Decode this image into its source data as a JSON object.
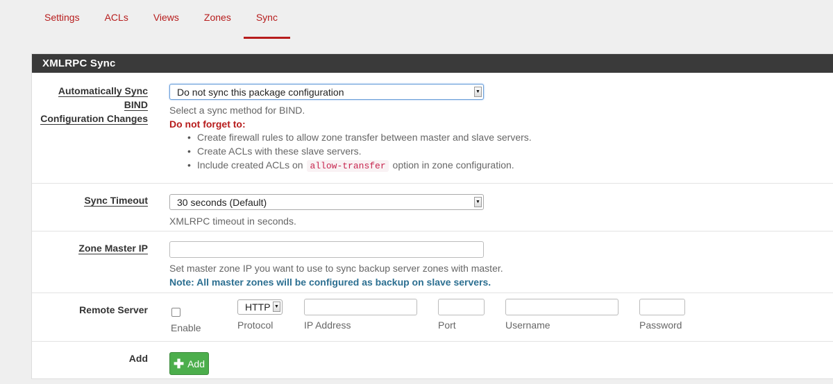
{
  "tabs": [
    {
      "label": "Settings",
      "active": false
    },
    {
      "label": "ACLs",
      "active": false
    },
    {
      "label": "Views",
      "active": false
    },
    {
      "label": "Zones",
      "active": false
    },
    {
      "label": "Sync",
      "active": true
    }
  ],
  "panel": {
    "title": "XMLRPC Sync"
  },
  "sync_method": {
    "label": "Automatically Sync BIND Configuration Changes",
    "label_line1": "Automatically Sync BIND",
    "label_line2": "Configuration Changes",
    "value": "Do not sync this package configuration",
    "help": "Select a sync method for BIND.",
    "warning": "Do not forget to:",
    "bullets": [
      "Create firewall rules to allow zone transfer between master and slave servers.",
      "Create ACLs with these slave servers."
    ],
    "bullet3_prefix": "Include created ACLs on",
    "bullet3_code": "allow-transfer",
    "bullet3_suffix": "option in zone configuration."
  },
  "sync_timeout": {
    "label": "Sync Timeout",
    "value": "30 seconds (Default)",
    "help": "XMLRPC timeout in seconds."
  },
  "zone_master_ip": {
    "label": "Zone Master IP",
    "value": "",
    "help": "Set master zone IP you want to use to sync backup server zones with master.",
    "note": "Note: All master zones will be configured as backup on slave servers."
  },
  "remote_server": {
    "label": "Remote Server",
    "enable_label": "Enable",
    "enabled": false,
    "protocol_value": "HTTP",
    "protocol_label": "Protocol",
    "ip_label": "IP Address",
    "port_label": "Port",
    "username_label": "Username",
    "password_label": "Password"
  },
  "add_row": {
    "label": "Add",
    "button_label": "Add",
    "button_color": "#4cae4c"
  },
  "colors": {
    "accent": "#b71c1c",
    "heading_bg": "#3a3a3a",
    "note": "#2c6f91"
  }
}
